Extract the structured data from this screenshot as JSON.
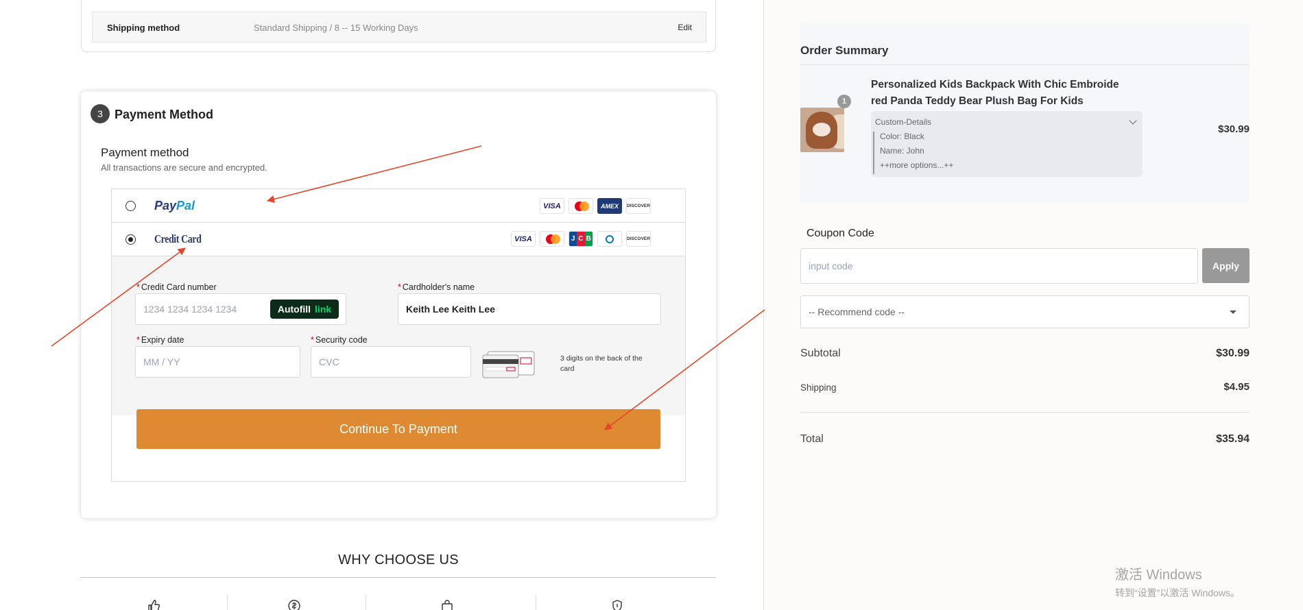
{
  "shipping": {
    "label": "Shipping method",
    "value": "Standard Shipping  /  8 -- 15 Working Days",
    "edit_label": "Edit"
  },
  "payment": {
    "step_number": "3",
    "title": "Payment Method",
    "method_heading": "Payment method",
    "method_subtext": "All transactions are secure and encrypted.",
    "paypal": {
      "logo_part1": "Pay",
      "logo_part2": "Pal",
      "cards": [
        "VISA",
        "mastercard",
        "AMEX",
        "DISCOVER"
      ]
    },
    "credit_card": {
      "logo": "Credit Card",
      "cards": [
        "VISA",
        "mastercard",
        "JCB",
        "Diners Club",
        "DISCOVER"
      ],
      "selected": true
    },
    "form": {
      "card_number_label": "Credit Card number",
      "card_number_placeholder": "1234 1234 1234 1234",
      "autofill_label": "Autofill",
      "autofill_link": "link",
      "holder_label": "Cardholder's name",
      "holder_value": "Keith Lee Keith Lee",
      "expiry_label": "Expiry date",
      "expiry_placeholder": "MM / YY",
      "security_label": "Security code",
      "security_placeholder": "CVC",
      "cvv_hint": "3 digits on the back of the card",
      "required_mark": "*"
    },
    "continue_label": "Continue To Payment"
  },
  "why": {
    "title": "WHY CHOOSE US"
  },
  "summary": {
    "title": "Order Summary",
    "product": {
      "name": "Personalized Kids Backpack With Chic Embroidered Panda Teddy Bear Plush Bag For Kids",
      "name_line1": "Personalized Kids Backpack With Chic Embroide",
      "name_line2": "red Panda Teddy Bear Plush Bag For Kids",
      "qty": "1",
      "price": "$30.99",
      "custom_heading": "Custom-Details",
      "custom_lines": [
        "Color: Black",
        "Name: John",
        "++more options...++"
      ]
    },
    "coupon_label": "Coupon Code",
    "coupon_placeholder": "input code",
    "apply_label": "Apply",
    "recommend_placeholder": "-- Recommend code --",
    "subtotal_label": "Subtotal",
    "subtotal_value": "$30.99",
    "shipping_label": "Shipping",
    "shipping_value": "$4.95",
    "total_label": "Total",
    "total_value": "$35.94"
  },
  "watermark": {
    "line1": "激活 Windows",
    "line2": "转到“设置”以激活 Windows。"
  },
  "colors": {
    "continue_button": "#de8a32",
    "annotation_arrow": "#e5472b",
    "apply_button": "#999999"
  }
}
